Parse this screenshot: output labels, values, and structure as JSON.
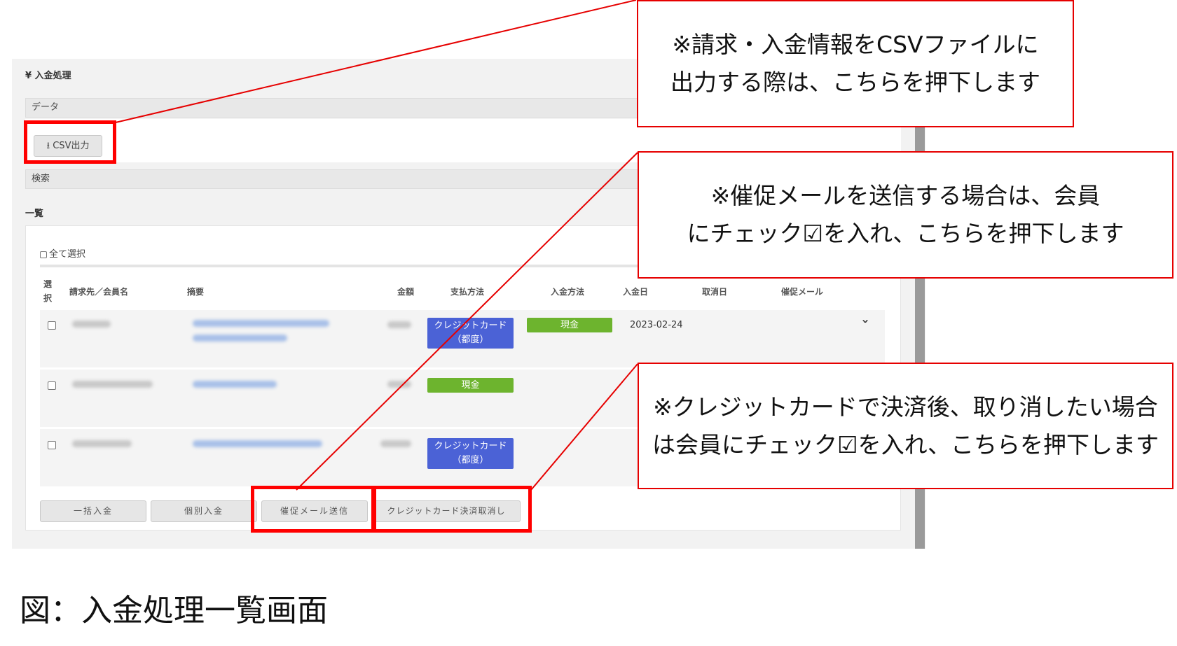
{
  "panel": {
    "title": "¥ 入金処理",
    "data_section": "データ",
    "csv_button": "CSV出力",
    "search_section": "検索",
    "list_title": "一覧",
    "select_all": "全て選択"
  },
  "table": {
    "headers": {
      "select": "選\n択",
      "member": "請求先／会員名",
      "summary": "摘要",
      "amount": "金額",
      "payment_method": "支払方法",
      "deposit_method": "入金方法",
      "deposit_date": "入金日",
      "cancel_date": "取消日",
      "reminder": "催促メール"
    },
    "rows": [
      {
        "payment_badge": "クレジットカード\n（都度）",
        "deposit_badge": "現金",
        "deposit_date": "2023-02-24"
      },
      {
        "payment_badge": "現金"
      },
      {
        "payment_badge": "クレジットカード\n（都度）"
      }
    ]
  },
  "actions": {
    "bulk_deposit": "一括入金",
    "individual_deposit": "個別入金",
    "send_reminder": "催促メール送信",
    "cancel_credit": "クレジットカード決済取消し"
  },
  "callouts": {
    "csv": "※請求・入金情報をCSVファイルに\n出力する際は、こちらを押下します",
    "reminder": "※催促メールを送信する場合は、会員\nにチェック☑を入れ、こちらを押下します",
    "cancel": "※クレジットカードで決済後、取り消したい場合\nは会員にチェック☑を入れ、こちらを押下します"
  },
  "caption": "図：入金処理一覧画面",
  "colors": {
    "badge_blue": "#4b62d6",
    "badge_green": "#6db42e",
    "highlight_red": "#ff0000"
  }
}
